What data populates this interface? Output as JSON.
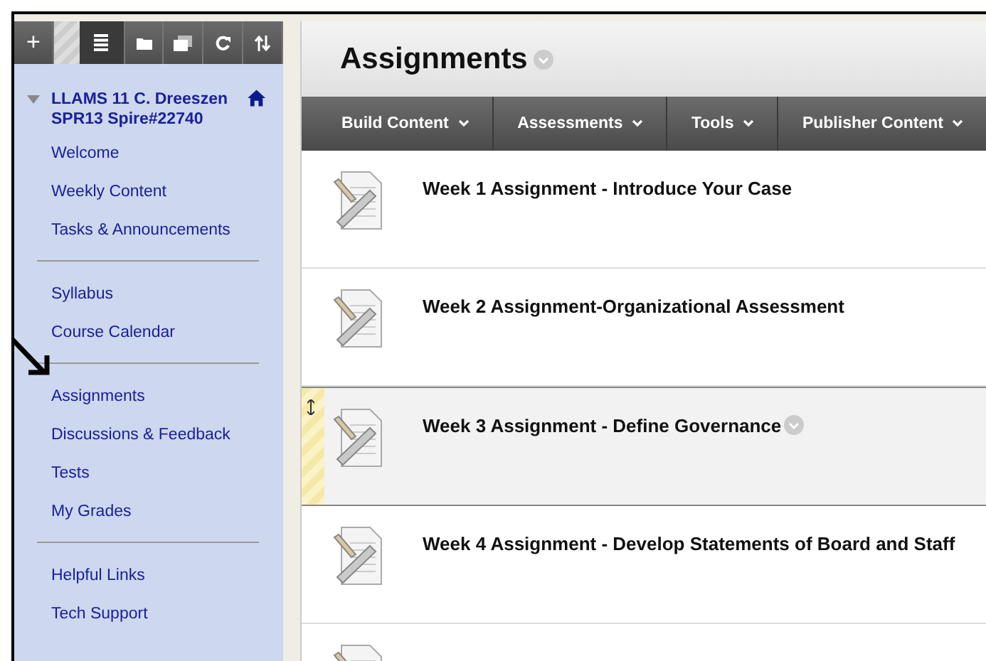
{
  "toolbar": [
    {
      "kind": "add",
      "label": "+",
      "selected": false
    },
    {
      "kind": "list",
      "selected": true
    },
    {
      "kind": "folder",
      "selected": false
    },
    {
      "kind": "window",
      "selected": false
    },
    {
      "kind": "refresh",
      "selected": false
    },
    {
      "kind": "sort",
      "selected": false
    }
  ],
  "course": {
    "title": "LLAMS 11 C. Dreeszen SPR13 Spire#22740",
    "expanded": true
  },
  "menu_groups": [
    [
      "Welcome",
      "Weekly Content",
      "Tasks & Announcements"
    ],
    [
      "Syllabus",
      "Course Calendar"
    ],
    [
      "Assignments",
      "Discussions & Feedback",
      "Tests",
      "My Grades"
    ],
    [
      "Helpful Links",
      "Tech Support"
    ]
  ],
  "page_title": "Assignments",
  "action_bar": [
    "Build Content",
    "Assessments",
    "Tools",
    "Publisher Content"
  ],
  "items": [
    {
      "title": "Week 1 Assignment - Introduce Your Case",
      "selected": false
    },
    {
      "title": "Week 2 Assignment-Organizational Assessment",
      "selected": false
    },
    {
      "title": "Week 3 Assignment - Define Governance",
      "selected": true
    },
    {
      "title": "Week 4 Assignment - Develop Statements of Board and Staff",
      "selected": false
    },
    {
      "selected": false
    }
  ]
}
